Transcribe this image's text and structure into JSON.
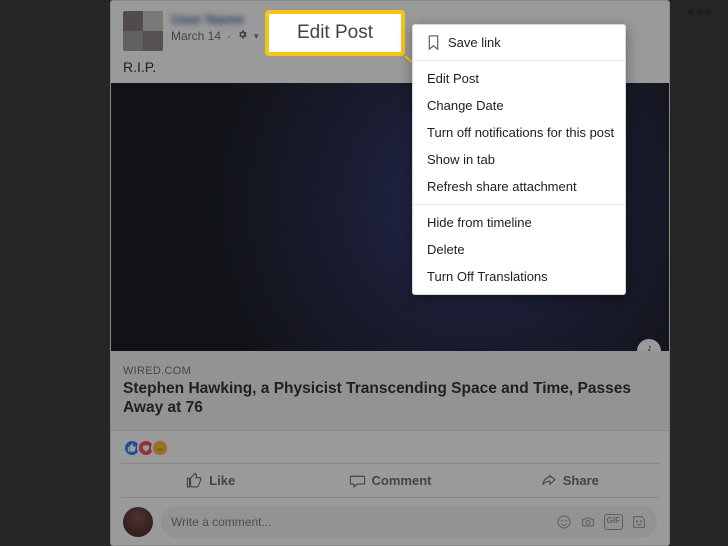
{
  "post": {
    "username": "User Name",
    "date": "March 14",
    "text": "R.I.P."
  },
  "link": {
    "source": "WIRED.COM",
    "title": "Stephen Hawking, a Physicist Transcending Space and Time, Passes Away at 76"
  },
  "actions": {
    "like": "Like",
    "comment": "Comment",
    "share": "Share"
  },
  "comment": {
    "placeholder": "Write a comment..."
  },
  "callout": {
    "label": "Edit Post"
  },
  "menu": {
    "save_link": "Save link",
    "edit_post": "Edit Post",
    "change_date": "Change Date",
    "turn_off_notifications": "Turn off notifications for this post",
    "show_in_tab": "Show in tab",
    "refresh_attachment": "Refresh share attachment",
    "hide_from_timeline": "Hide from timeline",
    "delete": "Delete",
    "turn_off_translations": "Turn Off Translations"
  },
  "info_badge": "i"
}
